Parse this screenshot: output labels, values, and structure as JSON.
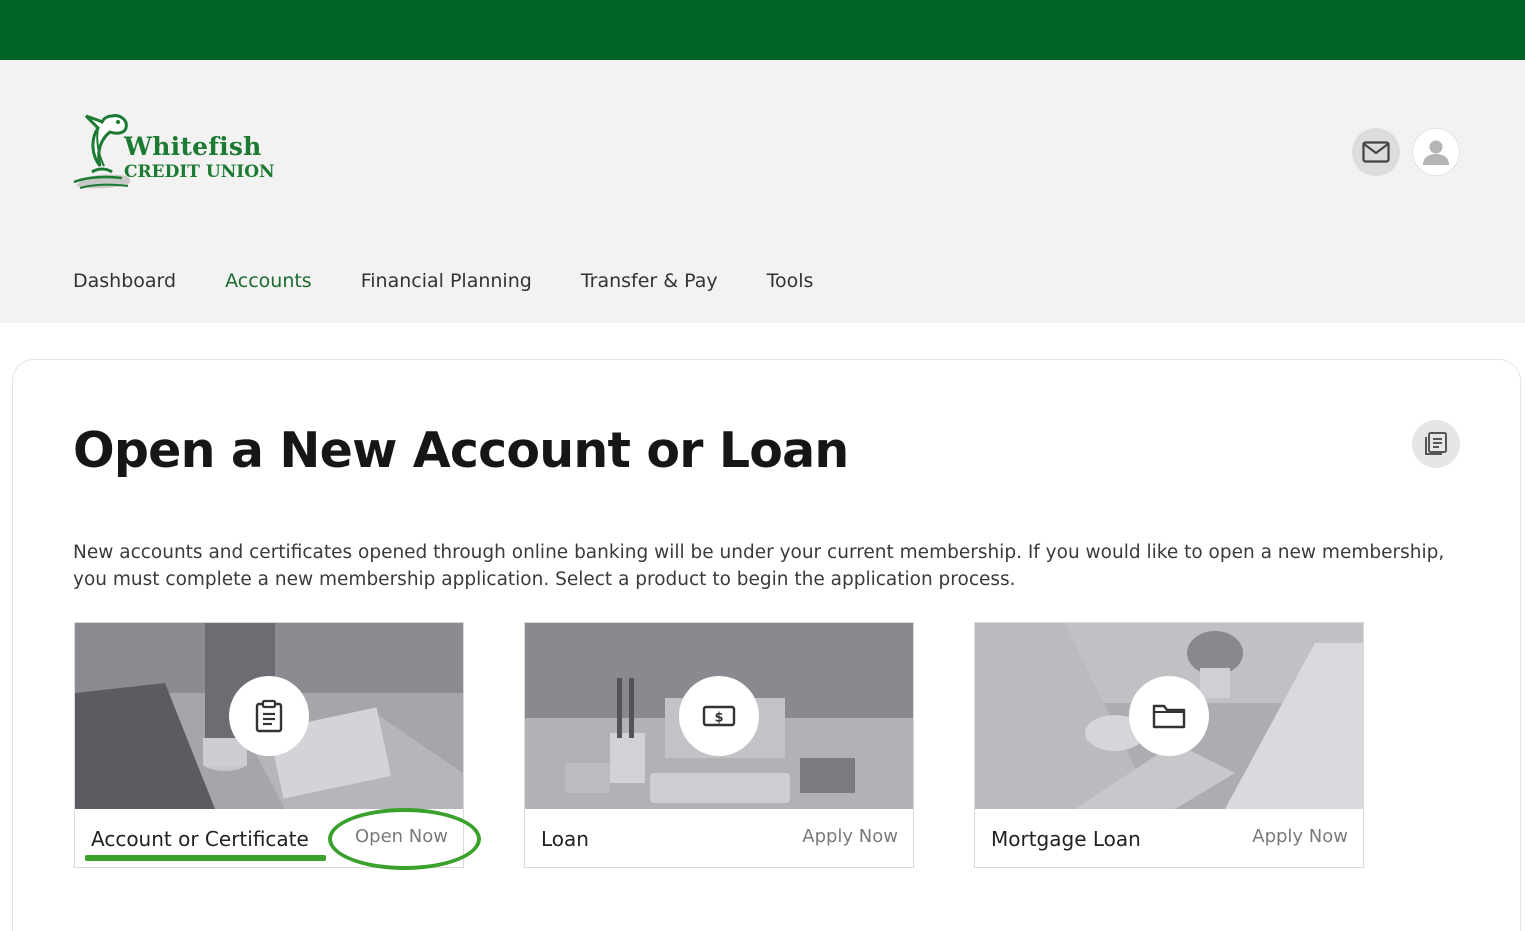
{
  "brand": {
    "name": "Whitefish",
    "subname": "CREDIT UNION",
    "primary_color": "#006325",
    "accent_color": "#1c7a32",
    "highlight_color": "#3aa12c"
  },
  "header": {
    "mail_icon": "mail-icon",
    "profile_icon": "user-silhouette-icon"
  },
  "nav": {
    "items": [
      {
        "label": "Dashboard",
        "active": false
      },
      {
        "label": "Accounts",
        "active": true
      },
      {
        "label": "Financial Planning",
        "active": false
      },
      {
        "label": "Transfer & Pay",
        "active": false
      },
      {
        "label": "Tools",
        "active": false
      }
    ]
  },
  "page": {
    "title": "Open a New Account or Loan",
    "intro": "New accounts and certificates opened through online banking will be under your current membership. If you would like to open a new membership, you must complete a new membership application. Select a product to begin the application process.",
    "doc_icon": "document-list-icon"
  },
  "products": [
    {
      "label": "Account or Certificate",
      "action": "Open Now",
      "icon": "clipboard-icon"
    },
    {
      "label": "Loan",
      "action": "Apply Now",
      "icon": "dollar-bill-icon"
    },
    {
      "label": "Mortgage Loan",
      "action": "Apply Now",
      "icon": "folder-icon"
    }
  ]
}
